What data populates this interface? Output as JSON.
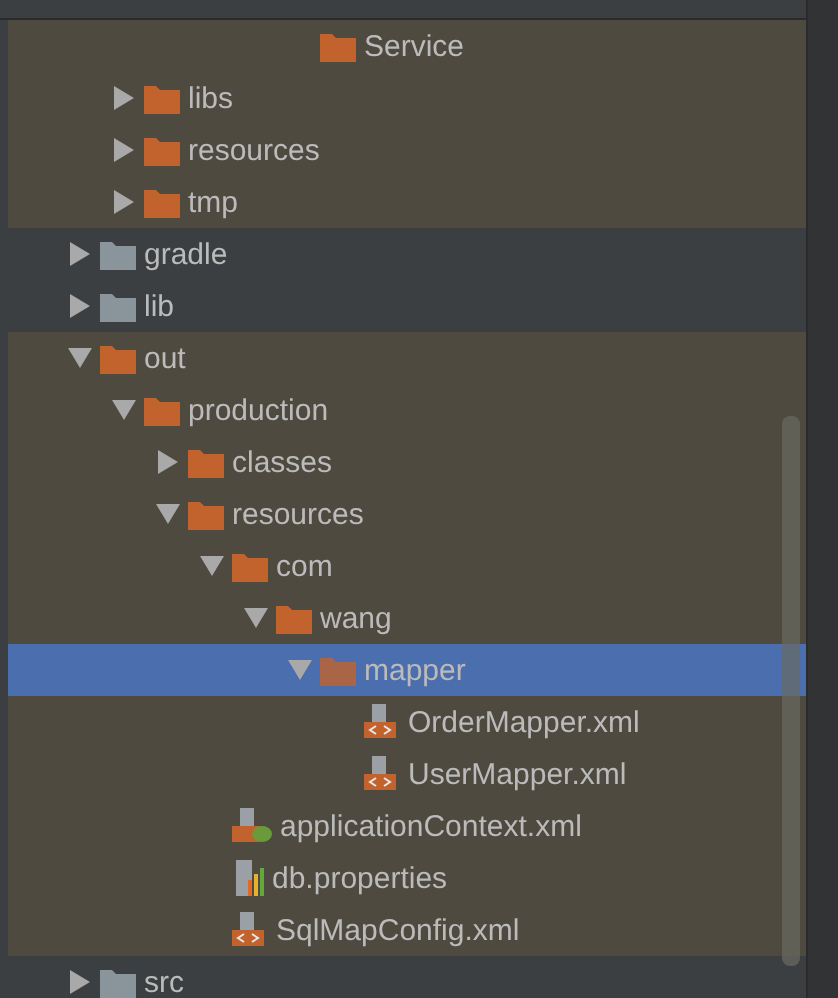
{
  "tree": [
    {
      "children": [
        {
          "children": [
            {
              "children": [
                {
                  "children": [
                    {
                      "children": [
                        {
                          "label": "Service",
                          "kind": "folder",
                          "tinted": true,
                          "selected": false
                        }
                      ]
                    }
                  ]
                }
              ]
            }
          ]
        },
        {
          "label": "libs",
          "kind": "folder",
          "expanded": false,
          "tinted": true,
          "selected": false
        },
        {
          "label": "resources",
          "kind": "folder",
          "expanded": false,
          "tinted": true,
          "selected": false
        },
        {
          "label": "tmp",
          "kind": "folder",
          "expanded": false,
          "tinted": true,
          "selected": false
        }
      ]
    },
    {
      "label": "gradle",
      "kind": "grey-folder",
      "expanded": false,
      "tinted": false,
      "selected": false
    },
    {
      "label": "lib",
      "kind": "grey-folder",
      "expanded": false,
      "tinted": false,
      "selected": false
    },
    {
      "label": "out",
      "kind": "folder",
      "expanded": true,
      "tinted": true,
      "selected": false,
      "children": [
        {
          "label": "production",
          "kind": "folder",
          "expanded": true,
          "tinted": true,
          "selected": false,
          "children": [
            {
              "label": "classes",
              "kind": "folder",
              "expanded": false,
              "tinted": true,
              "selected": false
            },
            {
              "label": "resources",
              "kind": "folder",
              "expanded": true,
              "tinted": true,
              "selected": false,
              "children": [
                {
                  "label": "com",
                  "kind": "folder",
                  "expanded": true,
                  "tinted": true,
                  "selected": false,
                  "children": [
                    {
                      "label": "wang",
                      "kind": "folder",
                      "expanded": true,
                      "tinted": true,
                      "selected": false,
                      "children": [
                        {
                          "label": "mapper",
                          "kind": "folder",
                          "expanded": true,
                          "selected": true,
                          "children": [
                            {
                              "label": "OrderMapper.xml",
                              "kind": "xml",
                              "tinted": true,
                              "selected": false
                            },
                            {
                              "label": "UserMapper.xml",
                              "kind": "xml",
                              "tinted": true,
                              "selected": false
                            }
                          ]
                        }
                      ]
                    }
                  ]
                },
                {
                  "label": "applicationContext.xml",
                  "kind": "spring-xml",
                  "tinted": true,
                  "selected": false
                },
                {
                  "label": "db.properties",
                  "kind": "properties",
                  "tinted": true,
                  "selected": false
                },
                {
                  "label": "SqlMapConfig.xml",
                  "kind": "xml",
                  "tinted": true,
                  "selected": false
                }
              ]
            }
          ]
        }
      ]
    },
    {
      "label": "src",
      "kind": "grey-folder",
      "expanded": false,
      "tinted": false,
      "selected": false
    }
  ]
}
